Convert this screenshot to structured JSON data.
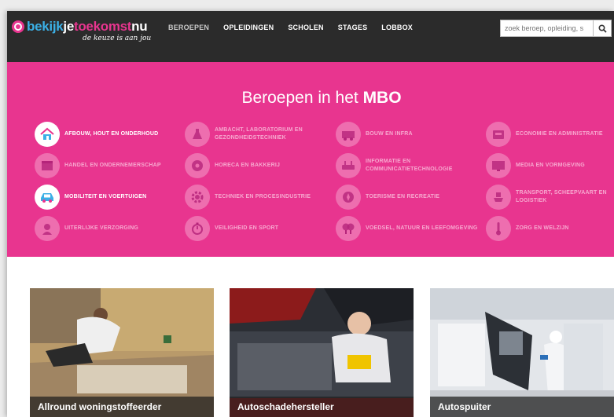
{
  "header": {
    "logo": {
      "part1": "bekijk",
      "part2": "je",
      "part3": "toekomst",
      "part4": "nu",
      "tagline": "de keuze is aan jou"
    },
    "nav": [
      "BEROEPEN",
      "OPLEIDINGEN",
      "SCHOLEN",
      "STAGES",
      "LOBBOX"
    ],
    "search": {
      "placeholder": "zoek beroep, opleiding, s"
    }
  },
  "hero": {
    "title_prefix": "Beroepen in het ",
    "title_strong": "MBO",
    "categories": [
      {
        "label": "Afbouw, hout en onderhoud",
        "icon": "house-icon",
        "active": true
      },
      {
        "label": "Ambacht, laboratorium en gezondheidstechniek",
        "icon": "flask-icon",
        "active": false
      },
      {
        "label": "Bouw en infra",
        "icon": "truck-icon",
        "active": false
      },
      {
        "label": "Economie en administratie",
        "icon": "cashregister-icon",
        "active": false
      },
      {
        "label": "Handel en ondernemerschap",
        "icon": "shop-icon",
        "active": false
      },
      {
        "label": "Horeca en bakkerij",
        "icon": "donut-icon",
        "active": false
      },
      {
        "label": "Informatie en communicatietechnologie",
        "icon": "router-icon",
        "active": false
      },
      {
        "label": "Media en vormgeving",
        "icon": "monitor-icon",
        "active": false
      },
      {
        "label": "Mobiliteit en voertuigen",
        "icon": "car-icon",
        "active": true
      },
      {
        "label": "Techniek en procesindustrie",
        "icon": "gear-icon",
        "active": false
      },
      {
        "label": "Toerisme en recreatie",
        "icon": "compass-icon",
        "active": false
      },
      {
        "label": "Transport, scheepvaart en logistiek",
        "icon": "ship-icon",
        "active": false
      },
      {
        "label": "Uiterlijke verzorging",
        "icon": "woman-icon",
        "active": false
      },
      {
        "label": "Veiligheid en sport",
        "icon": "stopwatch-icon",
        "active": false
      },
      {
        "label": "Voedsel, natuur en leefomgeving",
        "icon": "tree-icon",
        "active": false
      },
      {
        "label": "Zorg en welzijn",
        "icon": "thermometer-icon",
        "active": false
      }
    ]
  },
  "cards": [
    {
      "title": "Allround woningstoffeerder"
    },
    {
      "title": "Autoschadehersteller"
    },
    {
      "title": "Autospuiter"
    }
  ],
  "colors": {
    "brand_pink": "#e8358f",
    "brand_blue": "#3bb0e6",
    "header_bg": "#2b2b2b"
  }
}
